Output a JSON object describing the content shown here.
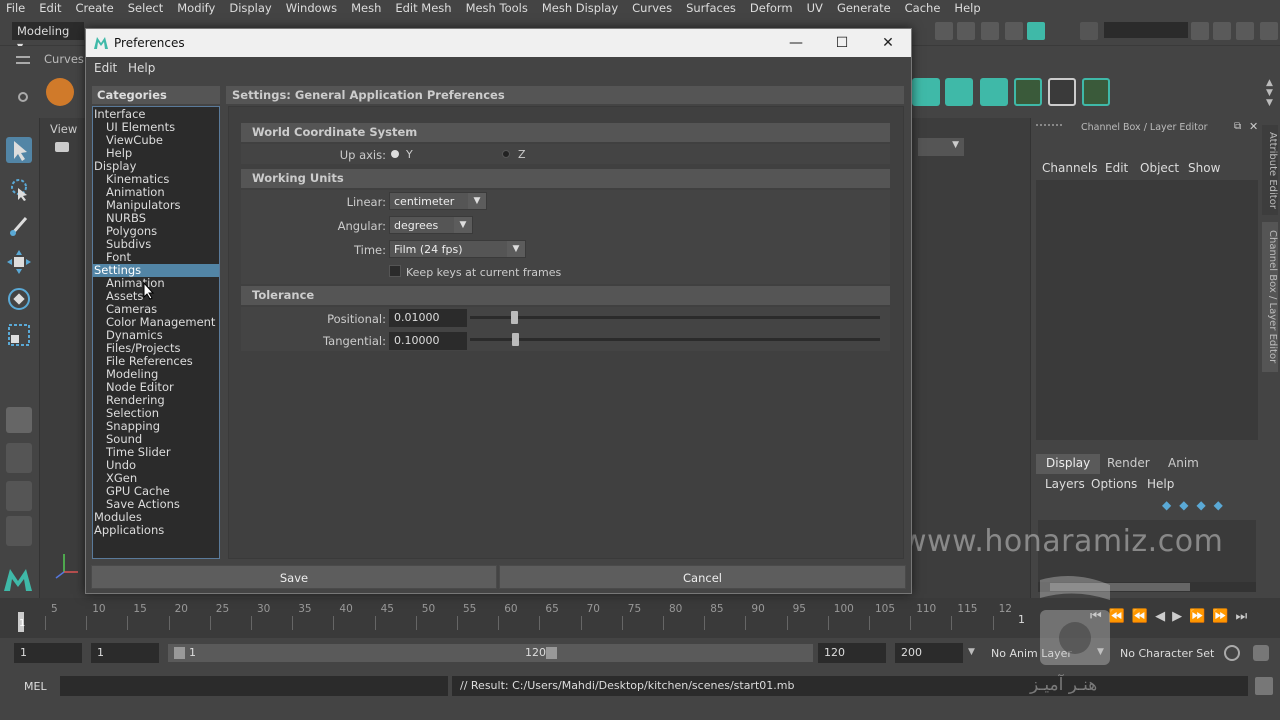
{
  "app": {
    "menu": [
      "File",
      "Edit",
      "Create",
      "Select",
      "Modify",
      "Display",
      "Windows",
      "Mesh",
      "Edit Mesh",
      "Mesh Tools",
      "Mesh Display",
      "Curves",
      "Surfaces",
      "Deform",
      "UV",
      "Generate",
      "Cache",
      "Help"
    ],
    "mode": "Modeling",
    "shelf_tab": "Curves",
    "viewport_menu": "View"
  },
  "channel_box": {
    "title": "Channel Box / Layer Editor",
    "menus": [
      "Channels",
      "Edit",
      "Object",
      "Show"
    ],
    "layer_tabs": [
      "Display",
      "Render",
      "Anim"
    ],
    "layer_menus": [
      "Layers",
      "Options",
      "Help"
    ],
    "side_tabs": [
      "Attribute Editor",
      "Channel Box / Layer Editor"
    ]
  },
  "timeline": {
    "ticks": [
      "5",
      "10",
      "15",
      "20",
      "25",
      "30",
      "35",
      "40",
      "45",
      "50",
      "55",
      "60",
      "65",
      "70",
      "75",
      "80",
      "85",
      "90",
      "95",
      "100",
      "105",
      "110",
      "115",
      "12"
    ],
    "current_frame_left": "1",
    "current_frame_right": "1"
  },
  "range": {
    "start": "1",
    "playback_start": "1",
    "slider_start": "1",
    "slider_end": "120",
    "playback_end": "120",
    "end": "200",
    "anim_layer": "No Anim Layer",
    "char_set": "No Character Set"
  },
  "command": {
    "lang": "MEL",
    "result": "// Result: C:/Users/Mahdi/Desktop/kitchen/scenes/start01.mb"
  },
  "prefs": {
    "title": "Preferences",
    "menu": [
      "Edit",
      "Help"
    ],
    "categories_header": "Categories",
    "categories": [
      {
        "label": "Interface",
        "indent": 0
      },
      {
        "label": "UI Elements",
        "indent": 1
      },
      {
        "label": "ViewCube",
        "indent": 1
      },
      {
        "label": "Help",
        "indent": 1
      },
      {
        "label": "Display",
        "indent": 0
      },
      {
        "label": "Kinematics",
        "indent": 1
      },
      {
        "label": "Animation",
        "indent": 1
      },
      {
        "label": "Manipulators",
        "indent": 1
      },
      {
        "label": "NURBS",
        "indent": 1
      },
      {
        "label": "Polygons",
        "indent": 1
      },
      {
        "label": "Subdivs",
        "indent": 1
      },
      {
        "label": "Font",
        "indent": 1
      },
      {
        "label": "Settings",
        "indent": 0,
        "selected": true
      },
      {
        "label": "Animation",
        "indent": 1
      },
      {
        "label": "Assets",
        "indent": 1
      },
      {
        "label": "Cameras",
        "indent": 1
      },
      {
        "label": "Color Management",
        "indent": 1
      },
      {
        "label": "Dynamics",
        "indent": 1
      },
      {
        "label": "Files/Projects",
        "indent": 1
      },
      {
        "label": "File References",
        "indent": 1
      },
      {
        "label": "Modeling",
        "indent": 1
      },
      {
        "label": "Node Editor",
        "indent": 1
      },
      {
        "label": "Rendering",
        "indent": 1
      },
      {
        "label": "Selection",
        "indent": 1
      },
      {
        "label": "Snapping",
        "indent": 1
      },
      {
        "label": "Sound",
        "indent": 1
      },
      {
        "label": "Time Slider",
        "indent": 1
      },
      {
        "label": "Undo",
        "indent": 1
      },
      {
        "label": "XGen",
        "indent": 1
      },
      {
        "label": "GPU Cache",
        "indent": 1
      },
      {
        "label": "Save Actions",
        "indent": 1
      },
      {
        "label": "Modules",
        "indent": 0
      },
      {
        "label": "Applications",
        "indent": 0
      }
    ],
    "settings_header": "Settings: General Application Preferences",
    "world": {
      "header": "World Coordinate System",
      "up_axis_label": "Up axis:",
      "opt_y": "Y",
      "opt_z": "Z",
      "selected": "Y"
    },
    "units": {
      "header": "Working Units",
      "linear_label": "Linear:",
      "linear_value": "centimeter",
      "angular_label": "Angular:",
      "angular_value": "degrees",
      "time_label": "Time:",
      "time_value": "Film (24 fps)",
      "keep_keys_label": "Keep keys at current frames",
      "keep_keys_checked": false
    },
    "tolerance": {
      "header": "Tolerance",
      "positional_label": "Positional:",
      "positional_value": "0.01000",
      "tangential_label": "Tangential:",
      "tangential_value": "0.10000"
    },
    "buttons": {
      "save": "Save",
      "cancel": "Cancel"
    }
  },
  "watermark": {
    "url": "www.honaramiz.com",
    "text": "هنـر آمیـز"
  },
  "colors": {
    "selection": "#5285a6",
    "accent_teal": "#3fb9a8"
  }
}
